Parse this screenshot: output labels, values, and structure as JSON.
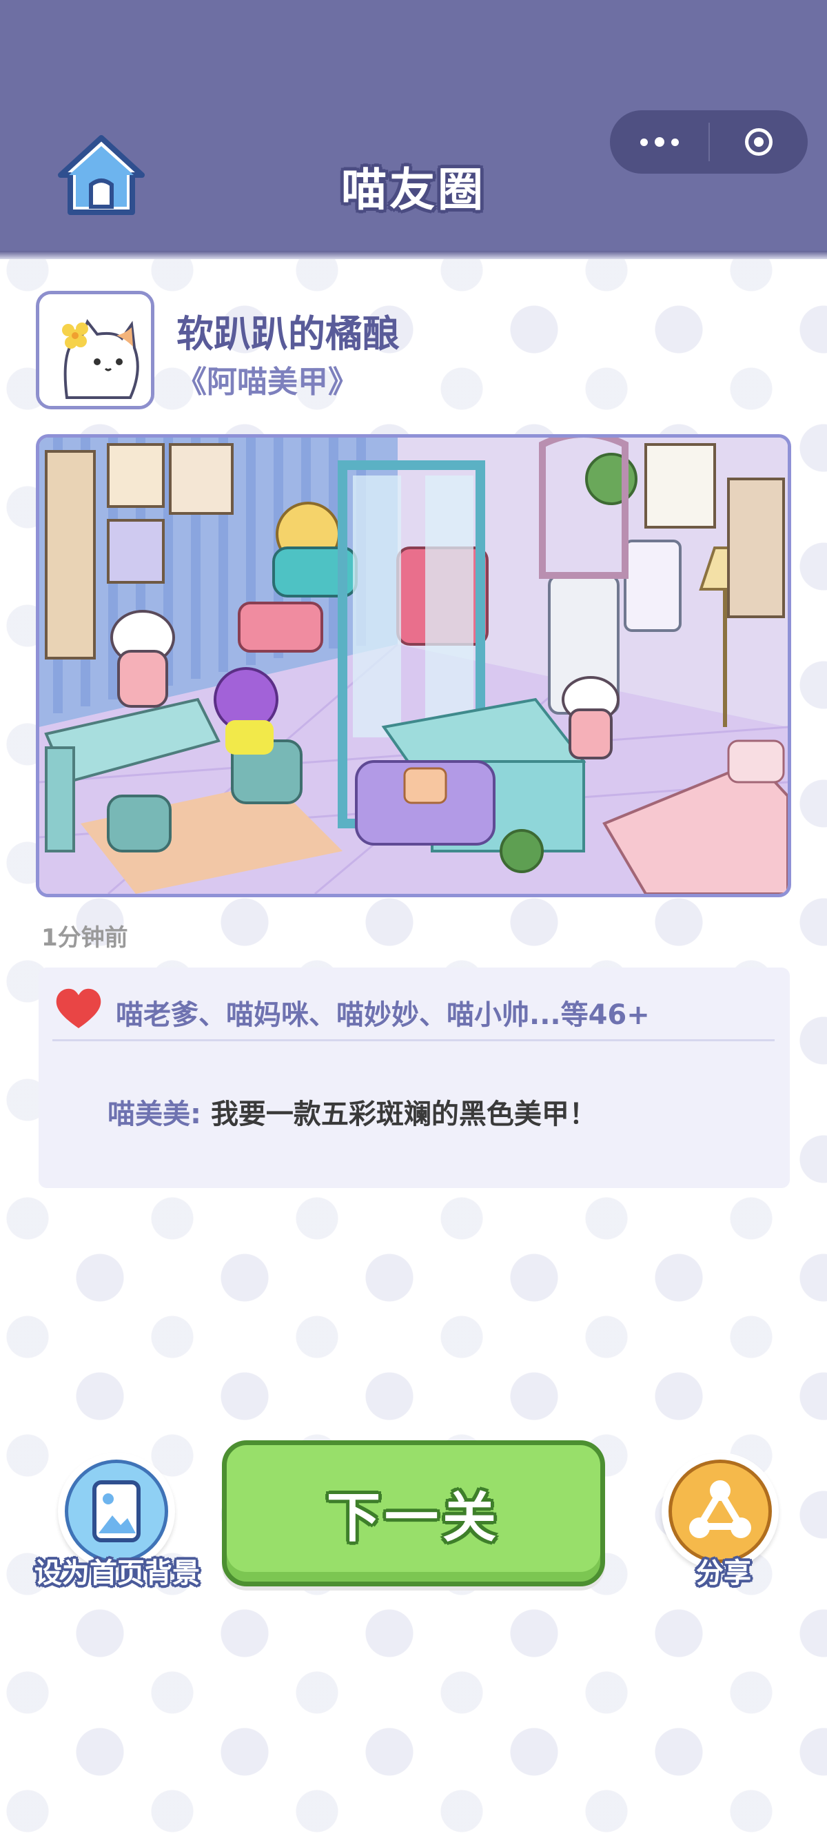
{
  "header": {
    "title": "喵友圈",
    "home_icon": "home-icon",
    "more_icon": "more-dots-icon",
    "close_icon": "target-circle-icon"
  },
  "post": {
    "user_name": "软趴趴的橘酿",
    "subtitle": "《阿喵美甲》",
    "time": "1分钟前",
    "likes": "喵老爹、喵妈咪、喵妙妙、喵小帅...等46+",
    "comment": {
      "author": "喵美美:",
      "text": "我要一款五彩斑斓的黑色美甲！"
    }
  },
  "actions": {
    "set_background": "设为首页背景",
    "next": "下一关",
    "share": "分享"
  },
  "colors": {
    "header": "#6e6fa3",
    "accent": "#6e72b0",
    "next_button": "#98df6a",
    "heart": "#e94545"
  }
}
